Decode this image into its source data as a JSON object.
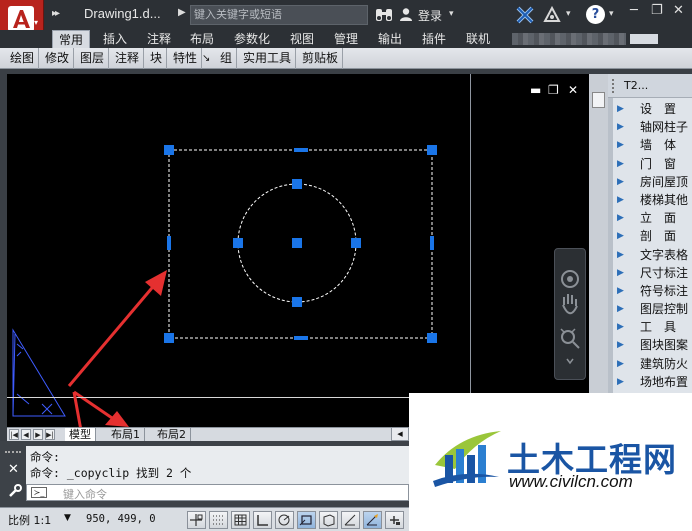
{
  "title_bar": {
    "document_title": "Drawing1.d...",
    "search_placeholder": "键入关键字或短语",
    "login_label": "登录",
    "minimize_glyph": "─",
    "restore_glyph": "❐",
    "close_glyph": "✕"
  },
  "ribbon": {
    "tabs": [
      "常用",
      "插入",
      "注释",
      "布局",
      "参数化",
      "视图",
      "管理",
      "输出",
      "插件",
      "联机"
    ],
    "active_tab": "常用",
    "panels": [
      "绘图",
      "修改",
      "图层",
      "注释",
      "块",
      "特性",
      "组",
      "实用工具",
      "剪贴板"
    ],
    "panel_expander": "↘"
  },
  "viewport": {
    "background": "#000000",
    "minimize_glyph": "▬",
    "restore_glyph": "❐",
    "close_glyph": "✕"
  },
  "side_panel": {
    "title": "T2...",
    "items": [
      "设　置",
      "轴网柱子",
      "墙　体",
      "门　窗",
      "房间屋顶",
      "楼梯其他",
      "立　面",
      "剖　面",
      "文字表格",
      "尺寸标注",
      "符号标注",
      "图层控制",
      "工　具",
      "图块图案",
      "建筑防火",
      "场地布置"
    ]
  },
  "layout_tabs": {
    "tabs": [
      "模型",
      "布局1",
      "布局2"
    ],
    "active_tab": "模型",
    "nav_arrows": [
      "|◀",
      "◀",
      "▶",
      "▶|"
    ],
    "scroll_left": "◀"
  },
  "command_line": {
    "history": [
      "命令:",
      "命令: _copyclip 找到 2 个"
    ],
    "placeholder": "键入命令",
    "close_glyph": "✕",
    "prompt_glyph": "≻_"
  },
  "status_bar": {
    "scale_label": "比例 1:1",
    "coordinates": "950, 499, 0"
  },
  "watermark": {
    "name": "土木工程网",
    "url": "www.civilcn.com"
  },
  "colors": {
    "accent_red": "#b8231d",
    "grip_blue": "#1a75e8",
    "arrow_red": "#e53030",
    "watermark_blue": "#1a55a4"
  }
}
